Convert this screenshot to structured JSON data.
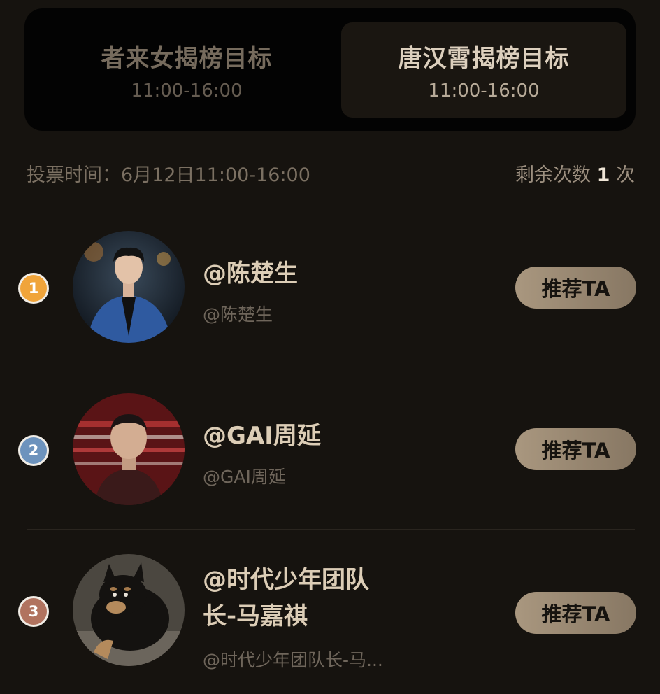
{
  "tabs": [
    {
      "title": "者来女揭榜目标",
      "time": "11:00-16:00",
      "active": false
    },
    {
      "title": "唐汉霄揭榜目标",
      "time": "11:00-16:00",
      "active": true
    }
  ],
  "info": {
    "vote_time": "投票时间：6月12日11:00-16:00",
    "remaining_prefix": "剩余次数",
    "remaining_count": "1",
    "remaining_suffix": "次"
  },
  "candidates": [
    {
      "rank": "1",
      "name": "@陈楚生",
      "name_line2": "",
      "handle": "@陈楚生",
      "button": "推荐TA",
      "rank_color": "#f0a43a"
    },
    {
      "rank": "2",
      "name": "@GAI周延",
      "name_line2": "",
      "handle": "@GAI周延",
      "button": "推荐TA",
      "rank_color": "#6d93bd"
    },
    {
      "rank": "3",
      "name": "@时代少年团队",
      "name_line2": "长-马嘉祺",
      "handle": "@时代少年团队长-马...",
      "button": "推荐TA",
      "rank_color": "#b1735f"
    }
  ],
  "colors": {
    "background": "#16130f",
    "accent_button": "#a9977f",
    "name_text": "#dccdb6"
  }
}
